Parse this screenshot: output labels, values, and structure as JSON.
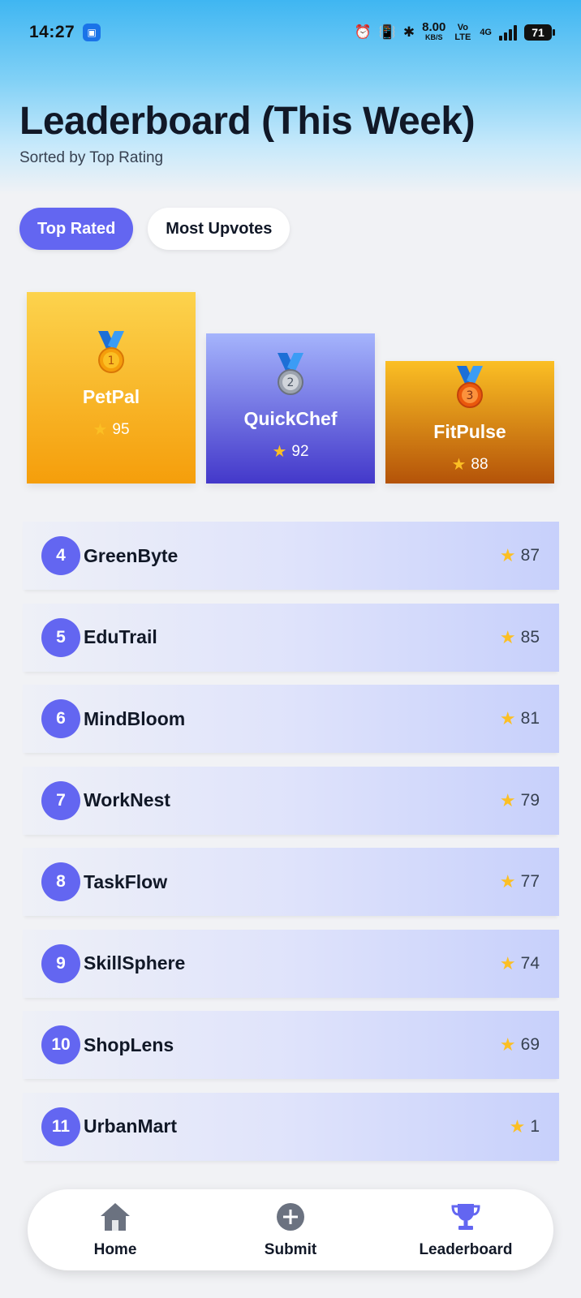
{
  "status_bar": {
    "time": "14:27",
    "net_speed": "8.00",
    "net_unit": "KB/S",
    "volte": "Vo LTE",
    "network": "4G",
    "battery": "71"
  },
  "header": {
    "title": "Leaderboard (This Week)",
    "subtitle": "Sorted by Top Rating"
  },
  "tabs": [
    {
      "label": "Top Rated",
      "active": true
    },
    {
      "label": "Most Upvotes",
      "active": false
    }
  ],
  "podium": [
    {
      "rank": "1",
      "name": "PetPal",
      "score": "95",
      "medal": "gold-medal-icon"
    },
    {
      "rank": "2",
      "name": "QuickChef",
      "score": "92",
      "medal": "silver-medal-icon"
    },
    {
      "rank": "3",
      "name": "FitPulse",
      "score": "88",
      "medal": "bronze-medal-icon"
    }
  ],
  "list": [
    {
      "rank": "4",
      "name": "GreenByte",
      "score": "87"
    },
    {
      "rank": "5",
      "name": "EduTrail",
      "score": "85"
    },
    {
      "rank": "6",
      "name": "MindBloom",
      "score": "81"
    },
    {
      "rank": "7",
      "name": "WorkNest",
      "score": "79"
    },
    {
      "rank": "8",
      "name": "TaskFlow",
      "score": "77"
    },
    {
      "rank": "9",
      "name": "SkillSphere",
      "score": "74"
    },
    {
      "rank": "10",
      "name": "ShopLens",
      "score": "69"
    },
    {
      "rank": "11",
      "name": "UrbanMart",
      "score": "1"
    }
  ],
  "bottom_nav": [
    {
      "label": "Home",
      "icon": "home-icon"
    },
    {
      "label": "Submit",
      "icon": "plus-circle-icon"
    },
    {
      "label": "Leaderboard",
      "icon": "trophy-icon"
    }
  ],
  "colors": {
    "accent": "#6366f1",
    "gold": "#f59e0b",
    "silver_card": "#4338ca",
    "bronze": "#b45309",
    "star": "#fbbf24"
  }
}
